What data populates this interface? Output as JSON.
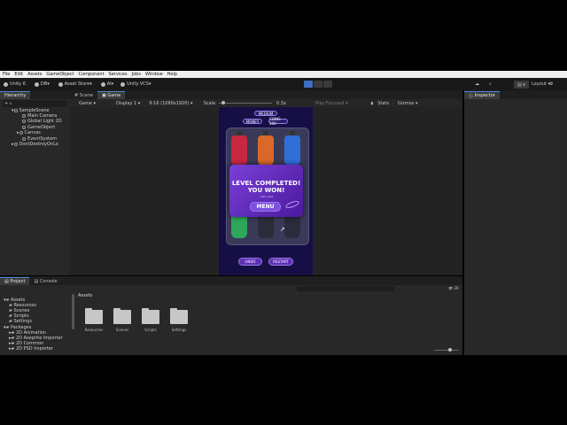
{
  "menubar": [
    "File",
    "Edit",
    "Assets",
    "GameObject",
    "Component",
    "Services",
    "Jobs",
    "Window",
    "Help"
  ],
  "toolbar": {
    "unity": "Unity 6",
    "account": "DB",
    "asset_store": "Asset Store",
    "ai": "AI",
    "vcs": "Unity VCS",
    "layout": "Layout"
  },
  "hierarchy": {
    "tab": "Hierarchy",
    "items": [
      "SampleScene",
      "Main Camera",
      "Global Light 2D",
      "GameObject",
      "Canvas",
      "EventSystem",
      "DontDestroyOnLo"
    ]
  },
  "center_tabs": [
    "Scene",
    "Game"
  ],
  "game_toolbar": {
    "mode": "Game",
    "display": "Display 1",
    "resolution": "9:16 (1080x1920)",
    "scale_label": "Scale",
    "scale_value": "0.3x",
    "play_focused": "Play Focused",
    "stats": "Stats",
    "gizmos": "Gizmos"
  },
  "game": {
    "level": "MEDIUM",
    "top_left_btn": "MONEY",
    "top_right_btn": "COINS 100",
    "modal_title_1": "LEVEL COMPLETED!",
    "modal_title_2": "YOU WON!",
    "modal_sub": "+10 coins",
    "menu_btn": "MENU",
    "undo_btn": "UNDO",
    "restart_btn": "RESTART"
  },
  "inspector": {
    "tab": "Inspector"
  },
  "project": {
    "tabs": [
      "Project",
      "Console"
    ],
    "tree": [
      "Assets",
      "Resources",
      "Scenes",
      "Scripts",
      "Settings",
      "Packages",
      "2D Animation",
      "2D Aseprite Importer",
      "2D Common",
      "2D PSD Importer"
    ],
    "breadcrumb": "Assets",
    "folders": [
      "Resources",
      "Scenes",
      "Scripts",
      "Settings"
    ],
    "count": "29"
  },
  "colors": {
    "bottle_red": "#c8273f",
    "bottle_orange": "#d8692a",
    "bottle_blue": "#2f6fd8",
    "bottle_green": "#2da85a",
    "bottle_empty": "#2b2b3b"
  }
}
